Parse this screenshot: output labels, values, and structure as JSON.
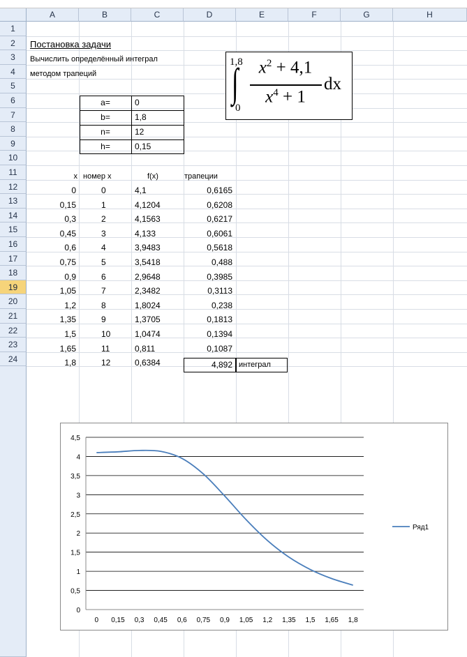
{
  "columns": [
    "A",
    "B",
    "C",
    "D",
    "E",
    "F",
    "G",
    "H"
  ],
  "rows": [
    "1",
    "2",
    "3",
    "4",
    "5",
    "6",
    "7",
    "8",
    "9",
    "10",
    "11",
    "12",
    "13",
    "14",
    "15",
    "16",
    "17",
    "18",
    "19",
    "20",
    "21",
    "22",
    "23",
    "24"
  ],
  "selected_row": "19",
  "title": "Постановка задачи",
  "task_line1": "Вычислить определённый интеграл",
  "task_line2": "методом трапеций",
  "formula": {
    "upper": "1,8",
    "lower": "0",
    "numerator_x": "x",
    "numerator_exp": "2",
    "numerator_rest": "+ 4,1",
    "denominator_x": "x",
    "denominator_exp": "4",
    "denominator_rest": "+ 1",
    "dx": "dx"
  },
  "params": [
    {
      "label": "a=",
      "value": "0"
    },
    {
      "label": "b=",
      "value": "1,8"
    },
    {
      "label": "n=",
      "value": "12"
    },
    {
      "label": "h=",
      "value": "0,15"
    }
  ],
  "table_headers": {
    "x": "x",
    "num": "номер x",
    "fx": "f(x)",
    "trap": "трапеции"
  },
  "table_rows": [
    {
      "x": "0",
      "num": "0",
      "fx": "4,1",
      "trap": "0,6165"
    },
    {
      "x": "0,15",
      "num": "1",
      "fx": "4,1204",
      "trap": "0,6208"
    },
    {
      "x": "0,3",
      "num": "2",
      "fx": "4,1563",
      "trap": "0,6217"
    },
    {
      "x": "0,45",
      "num": "3",
      "fx": "4,133",
      "trap": "0,6061"
    },
    {
      "x": "0,6",
      "num": "4",
      "fx": "3,9483",
      "trap": "0,5618"
    },
    {
      "x": "0,75",
      "num": "5",
      "fx": "3,5418",
      "trap": "0,488"
    },
    {
      "x": "0,9",
      "num": "6",
      "fx": "2,9648",
      "trap": "0,3985"
    },
    {
      "x": "1,05",
      "num": "7",
      "fx": "2,3482",
      "trap": "0,3113"
    },
    {
      "x": "1,2",
      "num": "8",
      "fx": "1,8024",
      "trap": "0,238"
    },
    {
      "x": "1,35",
      "num": "9",
      "fx": "1,3705",
      "trap": "0,1813"
    },
    {
      "x": "1,5",
      "num": "10",
      "fx": "1,0474",
      "trap": "0,1394"
    },
    {
      "x": "1,65",
      "num": "11",
      "fx": "0,811",
      "trap": "0,1087"
    },
    {
      "x": "1,8",
      "num": "12",
      "fx": "0,6384",
      "trap": ""
    }
  ],
  "result_value": "4,892",
  "result_label": "интеграл",
  "chart_data": {
    "type": "line",
    "categories": [
      "0",
      "0,15",
      "0,3",
      "0,45",
      "0,6",
      "0,75",
      "0,9",
      "1,05",
      "1,2",
      "1,35",
      "1,5",
      "1,65",
      "1,8"
    ],
    "series": [
      {
        "name": "Ряд1",
        "values": [
          4.1,
          4.1204,
          4.1563,
          4.133,
          3.9483,
          3.5418,
          2.9648,
          2.3482,
          1.8024,
          1.3705,
          1.0474,
          0.811,
          0.6384
        ]
      }
    ],
    "yticks": [
      "0",
      "0,5",
      "1",
      "1,5",
      "2",
      "2,5",
      "3",
      "3,5",
      "4",
      "4,5"
    ],
    "ylim": [
      0,
      4.5
    ],
    "grid": true,
    "legend": "right",
    "line_color": "#4a7ebb",
    "title": "",
    "xlabel": "",
    "ylabel": ""
  }
}
